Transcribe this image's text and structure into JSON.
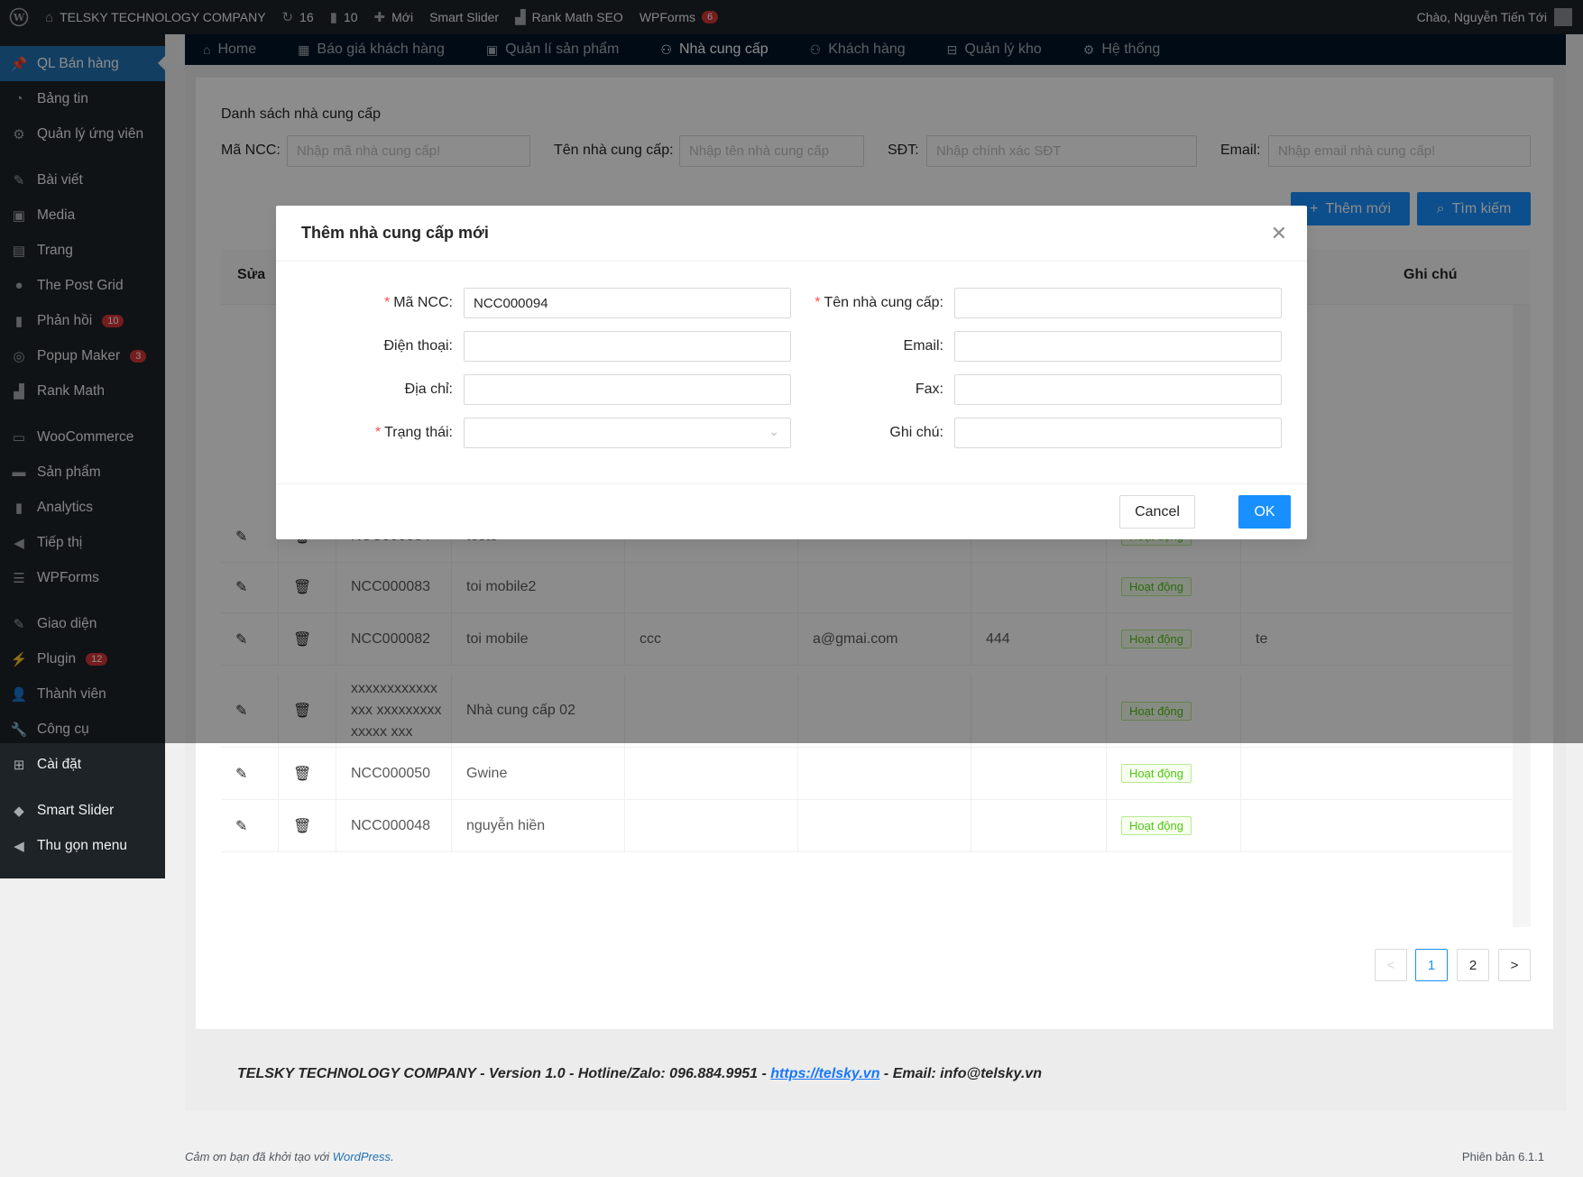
{
  "adminbar": {
    "site_name": "TELSKY TECHNOLOGY COMPANY",
    "updates_count": "16",
    "comments_count": "10",
    "new_label": "Mới",
    "smart_slider": "Smart Slider",
    "rank_math": "Rank Math SEO",
    "wpforms": "WPForms",
    "wpforms_badge": "6",
    "greeting": "Chào, Nguyễn Tiến Tới"
  },
  "sidebar": {
    "items": [
      {
        "label": "QL Bán hàng",
        "icon": "pin-icon"
      },
      {
        "label": "Bảng tin",
        "icon": "dashboard-icon"
      },
      {
        "label": "Quản lý ứng viên",
        "icon": "gear-icon"
      },
      {
        "label": "Bài viết",
        "icon": "pin-icon"
      },
      {
        "label": "Media",
        "icon": "media-icon"
      },
      {
        "label": "Trang",
        "icon": "page-icon"
      },
      {
        "label": "The Post Grid",
        "icon": "grid-icon"
      },
      {
        "label": "Phản hồi",
        "icon": "comment-icon",
        "count": "10"
      },
      {
        "label": "Popup Maker",
        "icon": "popup-icon",
        "count": "3"
      },
      {
        "label": "Rank Math",
        "icon": "chart-icon"
      },
      {
        "label": "WooCommerce",
        "icon": "woo-icon"
      },
      {
        "label": "Sản phẩm",
        "icon": "archive-icon"
      },
      {
        "label": "Analytics",
        "icon": "bar-chart-icon"
      },
      {
        "label": "Tiếp thị",
        "icon": "megaphone-icon"
      },
      {
        "label": "WPForms",
        "icon": "form-icon"
      },
      {
        "label": "Giao diện",
        "icon": "brush-icon"
      },
      {
        "label": "Plugin",
        "icon": "plugin-icon",
        "count": "12"
      },
      {
        "label": "Thành viên",
        "icon": "user-icon"
      },
      {
        "label": "Công cụ",
        "icon": "wrench-icon"
      },
      {
        "label": "Cài đặt",
        "icon": "settings-icon"
      },
      {
        "label": "Smart Slider",
        "icon": "slider-icon"
      },
      {
        "label": "Thu gọn menu",
        "icon": "collapse-icon"
      }
    ]
  },
  "topnav": {
    "items": [
      {
        "label": "Home"
      },
      {
        "label": "Báo giá khách hàng"
      },
      {
        "label": "Quản lí sản phẩm"
      },
      {
        "label": "Nhà cung cấp"
      },
      {
        "label": "Khách hàng"
      },
      {
        "label": "Quản lý kho"
      },
      {
        "label": "Hệ thống"
      }
    ]
  },
  "page": {
    "title": "Danh sách nhà cung cấp",
    "filters": {
      "ma_ncc_label": "Mã NCC",
      "ma_ncc_placeholder": "Nhập mã nhà cung cấp!",
      "ten_label": "Tên nhà cung cấp",
      "ten_placeholder": "Nhập tên nhà cung cấp",
      "sdt_label": "SĐT",
      "sdt_placeholder": "Nhập chính xác SĐT",
      "email_label": "Email",
      "email_placeholder": "Nhập email nhà cung cấp!"
    },
    "add_button": "Thêm mới",
    "search_button": "Tìm kiếm"
  },
  "table": {
    "headers": {
      "edit": "Sửa",
      "note": "Ghi chú"
    },
    "rows": [
      {
        "code": "NCC000084",
        "name": "test3",
        "address": "",
        "email": "",
        "phone": "",
        "status": "Hoạt động",
        "note": ""
      },
      {
        "code": "NCC000083",
        "name": "toi mobile2",
        "address": "",
        "email": "",
        "phone": "",
        "status": "Hoạt động",
        "note": ""
      },
      {
        "code": "NCC000082",
        "name": "toi mobile",
        "address": "ccc",
        "email": "a@gmai.com",
        "phone": "444",
        "status": "Hoạt động",
        "note": "te"
      },
      {
        "code": "xxxxxxxxxxxxxxx xxxxxxxxxxxxxx xxx",
        "name": "Nhà cung cấp 02",
        "address": "",
        "email": "",
        "phone": "",
        "status": "Hoạt động",
        "note": ""
      },
      {
        "code": "NCC000050",
        "name": "Gwine",
        "address": "",
        "email": "",
        "phone": "",
        "status": "Hoạt động",
        "note": ""
      },
      {
        "code": "NCC000048",
        "name": "nguyễn hiền",
        "address": "",
        "email": "",
        "phone": "",
        "status": "Hoạt động",
        "note": ""
      }
    ]
  },
  "pagination": {
    "prev": "<",
    "page1": "1",
    "page2": "2",
    "next": ">"
  },
  "footer": {
    "company_text": "TELSKY TECHNOLOGY COMPANY - Version 1.0 - Hotline/Zalo: 096.884.9951 - ",
    "link": "https://telsky.vn",
    "email_text": " - Email: info@telsky.vn",
    "wp_thanks": "Cảm ơn bạn đã khởi tạo với ",
    "wp_link": "WordPress",
    "wp_end": ".",
    "version": "Phiên bản 6.1.1"
  },
  "modal": {
    "title": "Thêm nhà cung cấp mới",
    "ma_ncc_label": "Mã NCC",
    "ma_ncc_value": "NCC000094",
    "ten_label": "Tên nhà cung cấp",
    "ten_value": "",
    "dien_thoai_label": "Điện thoại",
    "email_label": "Email",
    "dia_chi_label": "Địa chỉ",
    "fax_label": "Fax",
    "trang_thai_label": "Trạng thái",
    "ghi_chu_label": "Ghi chú",
    "cancel": "Cancel",
    "ok": "OK"
  },
  "colors": {
    "primary": "#1890ff",
    "wp_dark": "#1d2327",
    "wp_blue": "#2271b1",
    "nav_dark": "#001529",
    "success": "#52c41a"
  }
}
